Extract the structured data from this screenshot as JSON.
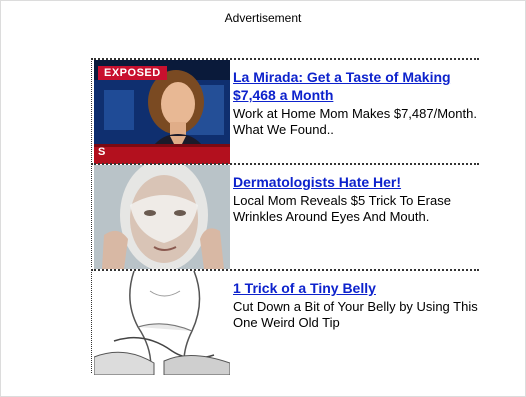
{
  "header": {
    "label": "Advertisement"
  },
  "ads": [
    {
      "title": "La Mirada: Get a Taste of Making $7,468 a Month",
      "description": "Work at Home Mom Makes $7,487/Month. What We Found..",
      "image_icon": "news-anchor-image",
      "badge": "EXPOSED",
      "ticker": "S"
    },
    {
      "title": "Dermatologists Hate Her!",
      "description": "Local Mom Reveals $5 Trick To Erase Wrinkles Around Eyes And Mouth.",
      "image_icon": "face-peel-image"
    },
    {
      "title": "1 Trick of a Tiny Belly",
      "description": "Cut Down a Bit of Your Belly by Using This One Weird Old Tip",
      "image_icon": "belly-sketch-image"
    }
  ],
  "colors": {
    "link": "#0d22cc",
    "badge": "#c8102e"
  }
}
